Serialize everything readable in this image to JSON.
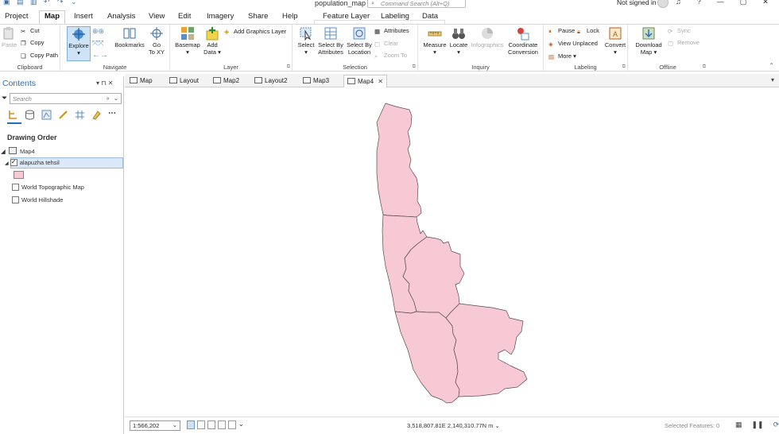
{
  "title_bar": {
    "document_title": "population_map",
    "command_search_placeholder": "Command Search (Alt+Q)",
    "signin_text": "Not signed in",
    "win_minimize": "—",
    "win_maximize": "▢",
    "win_close": "✕",
    "help": "?"
  },
  "ribbon_tabs": [
    "Project",
    "Map",
    "Insert",
    "Analysis",
    "View",
    "Edit",
    "Imagery",
    "Share",
    "Help",
    "Feature Layer",
    "Labeling",
    "Data"
  ],
  "ribbon": {
    "clipboard": {
      "paste": "Paste",
      "cut": "Cut",
      "copy": "Copy",
      "copy_path": "Copy Path",
      "label": "Clipboard"
    },
    "navigate": {
      "explore": "Explore",
      "bookmarks": "Bookmarks",
      "go_to_xy": "Go\nTo XY",
      "go_to_xy_l1": "Go",
      "go_to_xy_l2": "To XY",
      "label": "Navigate"
    },
    "layer": {
      "basemap": "Basemap",
      "add_data_l1": "Add",
      "add_data_l2": "Data ▾",
      "add_graphics_layer": "Add Graphics Layer",
      "label": "Layer"
    },
    "selection": {
      "select": "Select",
      "select_by_attributes_l1": "Select By",
      "select_by_attributes_l2": "Attributes",
      "select_by_location_l1": "Select By",
      "select_by_location_l2": "Location",
      "attributes": "Attributes",
      "clear": "Clear",
      "zoom_to": "Zoom To",
      "label": "Selection"
    },
    "inquiry": {
      "measure": "Measure",
      "locate": "Locate",
      "infographics": "Infographics",
      "coordinate_conversion_l1": "Coordinate",
      "coordinate_conversion_l2": "Conversion",
      "label": "Inquiry"
    },
    "labeling": {
      "pause": "Pause",
      "lock": "Lock",
      "view_unplaced": "View Unplaced",
      "more": "More ▾",
      "convert": "Convert",
      "label": "Labeling"
    },
    "offline": {
      "download_map_l1": "Download",
      "download_map_l2": "Map ▾",
      "sync": "Sync",
      "remove": "Remove",
      "label": "Offline"
    }
  },
  "contents": {
    "title": "Contents",
    "search_placeholder": "Search",
    "drawing_order": "Drawing Order",
    "map_name": "Map4",
    "layers": [
      {
        "name": "alapuzha tehsil",
        "checked": true
      },
      {
        "name": "World Topographic Map",
        "checked": false
      },
      {
        "name": "World Hillshade",
        "checked": false
      }
    ],
    "pane_ctl": "▾ ⊓ ✕"
  },
  "view_tabs": [
    "Map",
    "Layout",
    "Map2",
    "Layout2",
    "Map3",
    "Map4"
  ],
  "view_tab_close": "✕",
  "view_tabs_ctl": "▾",
  "status_bar": {
    "scale": "1:566,202",
    "coordinates": "3,518,807.81E 2,140,310.77N m",
    "selected_features": "Selected Features: 0"
  },
  "colors": {
    "polygon_fill": "#f6c9d4",
    "polygon_stroke": "#5a4a50",
    "accent": "#2a6ebb"
  }
}
